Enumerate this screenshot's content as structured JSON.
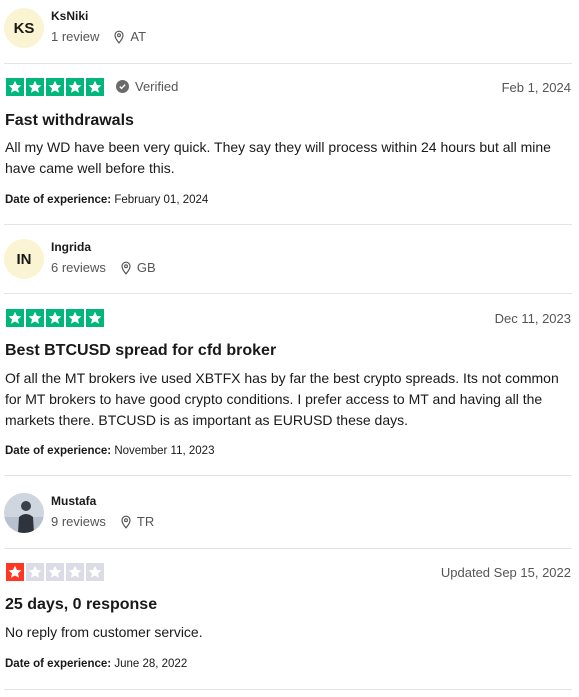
{
  "colors": {
    "star_green": "#00b67a",
    "star_red": "#ff3722",
    "star_empty": "#dcdce6",
    "avatar_bg": "#fbf4d3",
    "divider": "#e5e5dd"
  },
  "reviews": [
    {
      "consumer": {
        "initials": "KS",
        "name": "KsNiki",
        "review_count": "1 review",
        "country": "AT"
      },
      "rating": 5,
      "verified_label": "Verified",
      "date": "Feb 1, 2024",
      "title": "Fast withdrawals",
      "body": "All my WD have been very quick. They say they will process within 24 hours but all mine have came well before this.",
      "exp_label": "Date of experience:",
      "exp_date": "February 01, 2024"
    },
    {
      "consumer": {
        "initials": "IN",
        "name": "Ingrida",
        "review_count": "6 reviews",
        "country": "GB"
      },
      "rating": 5,
      "date": "Dec 11, 2023",
      "title": "Best BTCUSD spread for cfd broker",
      "body": "Of all the MT brokers ive used XBTFX has by far the best crypto spreads. Its not common for MT brokers to have good crypto conditions. I prefer access to MT and having all the markets there. BTCUSD is as important as EURUSD these days.",
      "exp_label": "Date of experience:",
      "exp_date": "November 11, 2023"
    },
    {
      "consumer": {
        "initials": "",
        "avatar_icon": "user-photo-icon",
        "name": "Mustafa",
        "review_count": "9 reviews",
        "country": "TR"
      },
      "rating": 1,
      "date": "Updated Sep 15, 2022",
      "title": "25 days, 0 response",
      "body": "No reply from customer service.",
      "exp_label": "Date of experience:",
      "exp_date": "June 28, 2022"
    }
  ]
}
